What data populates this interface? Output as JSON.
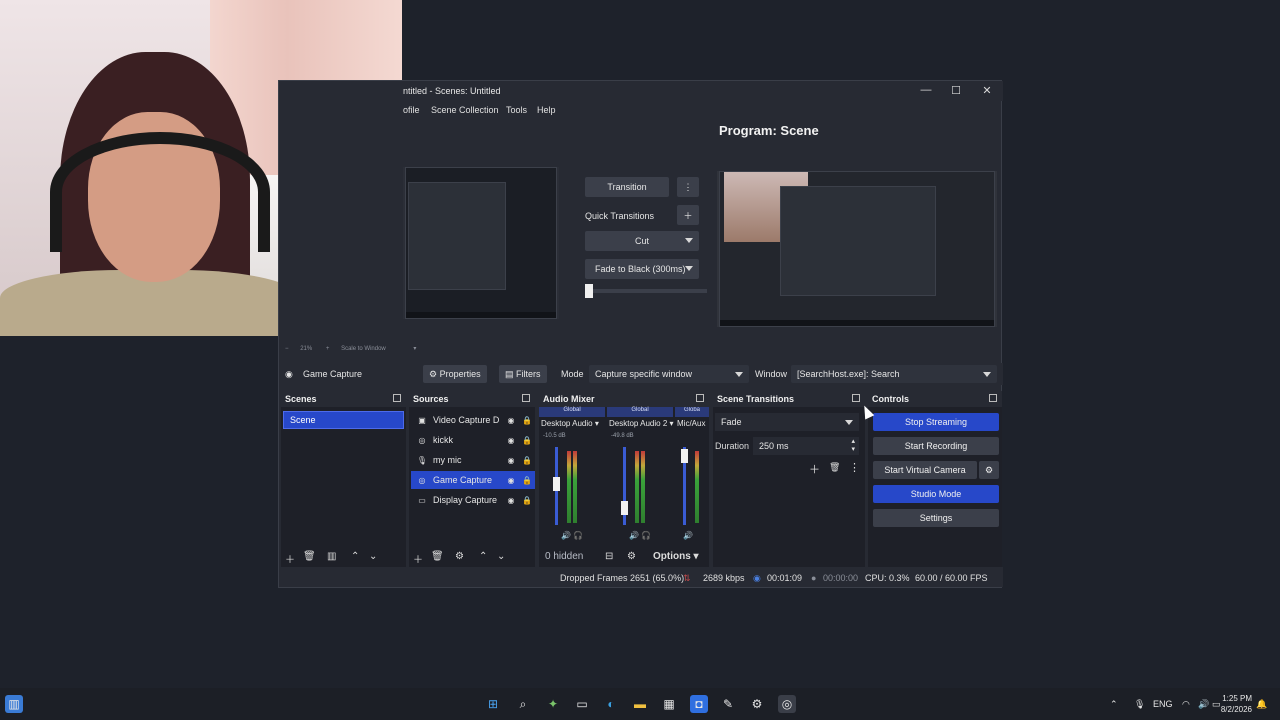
{
  "window": {
    "title": "ntitled - Scenes: Untitled",
    "minimize_icon": "minimize-icon",
    "maximize_icon": "maximize-icon",
    "close_icon": "close-icon"
  },
  "menu": [
    "ofile",
    "Scene Collection",
    "Tools",
    "Help"
  ],
  "program_label": "Program: Scene",
  "transitions": {
    "transition_label": "Transition",
    "quick_label": "Quick Transitions",
    "cut_label": "Cut",
    "fade_label": "Fade to Black (300ms)"
  },
  "zoom": {
    "percent": "21%",
    "mode": "Scale to Window"
  },
  "source_toolbar": {
    "source_name": "Game Capture",
    "properties_label": "Properties",
    "filters_label": "Filters",
    "mode_label": "Mode",
    "mode_value": "Capture specific window",
    "window_label": "Window",
    "window_value": "[SearchHost.exe]: Search"
  },
  "scenes": {
    "title": "Scenes",
    "items": [
      "Scene"
    ]
  },
  "sources": {
    "title": "Sources",
    "items": [
      {
        "name": "Video Capture D",
        "icon": "camera-icon",
        "selected": false
      },
      {
        "name": "kickk",
        "icon": "game-icon",
        "selected": false
      },
      {
        "name": "my mic",
        "icon": "microphone-icon",
        "selected": false
      },
      {
        "name": "Game Capture",
        "icon": "gamepad-icon",
        "selected": true
      },
      {
        "name": "Display Capture",
        "icon": "monitor-icon",
        "selected": false
      }
    ]
  },
  "mixer": {
    "title": "Audio Mixer",
    "channels": [
      {
        "global": "Global",
        "name": "Desktop Audio",
        "db": "-10.5 dB"
      },
      {
        "global": "Global",
        "name": "Desktop Audio 2",
        "db": "-49.8 dB"
      },
      {
        "global": "Globa",
        "name": "Mic/Aux",
        "db": ""
      }
    ],
    "hidden_label": "0 hidden",
    "options_label": "Options"
  },
  "scene_transitions": {
    "title": "Scene Transitions",
    "type_value": "Fade",
    "duration_label": "Duration",
    "duration_value": "250 ms"
  },
  "controls": {
    "title": "Controls",
    "stop_streaming": "Stop Streaming",
    "start_recording": "Start Recording",
    "start_virtual_camera": "Start Virtual Camera",
    "studio_mode": "Studio Mode",
    "settings": "Settings"
  },
  "status": {
    "dropped_frames": "Dropped Frames 2651 (65.0%)",
    "bitrate": "2689 kbps",
    "stream_time": "00:01:09",
    "record_time": "00:00:00",
    "cpu": "CPU: 0.3%",
    "fps": "60.00 / 60.00 FPS"
  },
  "taskbar": {
    "language": "ENG",
    "time": "1:25 PM",
    "date": "8/2/2026"
  },
  "colors": {
    "accent_blue": "#2748c9",
    "panel_bg": "#1e2028",
    "window_bg": "#272a33"
  }
}
